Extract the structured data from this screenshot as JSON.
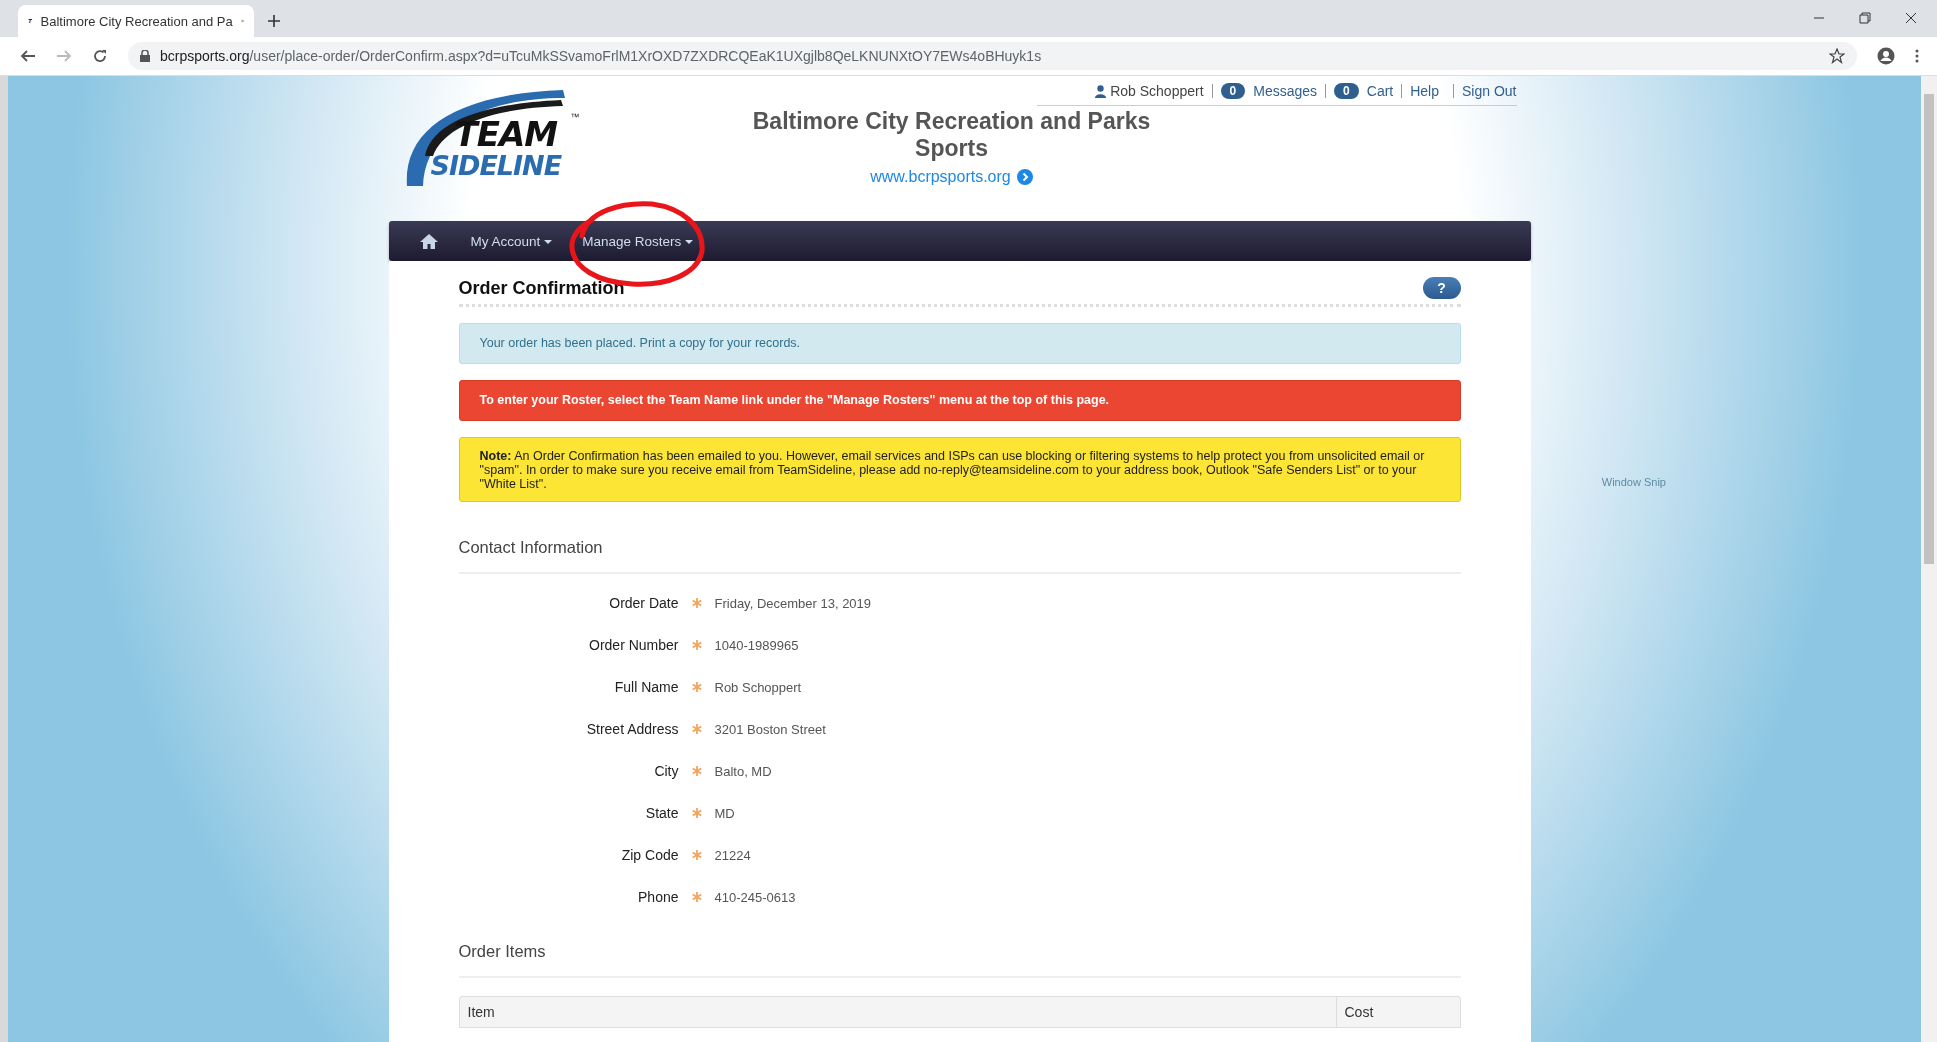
{
  "browser": {
    "tab_title": "Baltimore City Recreation and Pa",
    "url_domain": "bcrpsports.org",
    "url_path": "/user/place-order/OrderConfirm.aspx?d=uTcuMkSSvamoFrlM1XrOXD7ZXDRCQEaK1UXgjlb8QeLKNUNXtOY7EWs4oBHuyk1s"
  },
  "logo": {
    "line1": "TEAM",
    "line2": "SIDELINE",
    "mark": "™"
  },
  "top_links": {
    "user": "Rob Schoppert",
    "messages_count": "0",
    "messages": "Messages",
    "cart_count": "0",
    "cart": "Cart",
    "help": "Help",
    "sign_out": "Sign Out"
  },
  "site_title": "Baltimore City Recreation and Parks Sports",
  "site_link": "www.bcrpsports.org",
  "nav": [
    {
      "label": "My Account",
      "dropdown": true,
      "circled": false
    },
    {
      "label": "Manage Rosters",
      "dropdown": true,
      "circled": true
    }
  ],
  "page_title": "Order Confirmation",
  "help_button": "?",
  "alerts": [
    {
      "kind": "info",
      "text": "Your order has been placed. Print a copy for your records."
    },
    {
      "kind": "danger",
      "text": "To enter your Roster, select the Team Name link under the \"Manage Rosters\" menu at the top of this page."
    },
    {
      "kind": "warning",
      "text": "**Note:** An Order Confirmation has been emailed to you. However, email services and ISPs can use blocking or filtering systems to help protect you from unsolicited email or \"spam\". In order to make sure you receive email from TeamSideline, please add no-reply@teamsideline.com to your address book, Outlook \"Safe Senders List\" or to your \"White List\"."
    }
  ],
  "contact": {
    "title": "Contact Information",
    "fields": [
      {
        "label": "Order Date",
        "required": true,
        "value": "Friday, December 13, 2019"
      },
      {
        "label": "Order Number",
        "required": true,
        "value": "1040-1989965"
      },
      {
        "label": "Full Name",
        "required": true,
        "value": "Rob Schoppert"
      },
      {
        "label": "Street Address",
        "required": true,
        "value": "3201 Boston Street"
      },
      {
        "label": "City",
        "required": true,
        "value": "Balto, MD"
      },
      {
        "label": "State",
        "required": true,
        "value": "MD"
      },
      {
        "label": "Zip Code",
        "required": true,
        "value": "21224"
      },
      {
        "label": "Phone",
        "required": true,
        "value": "410-245-0613"
      }
    ]
  },
  "order_items": {
    "title": "Order Items",
    "columns": [
      "Item",
      "Cost"
    ]
  },
  "snip_hint": "Window Snip"
}
